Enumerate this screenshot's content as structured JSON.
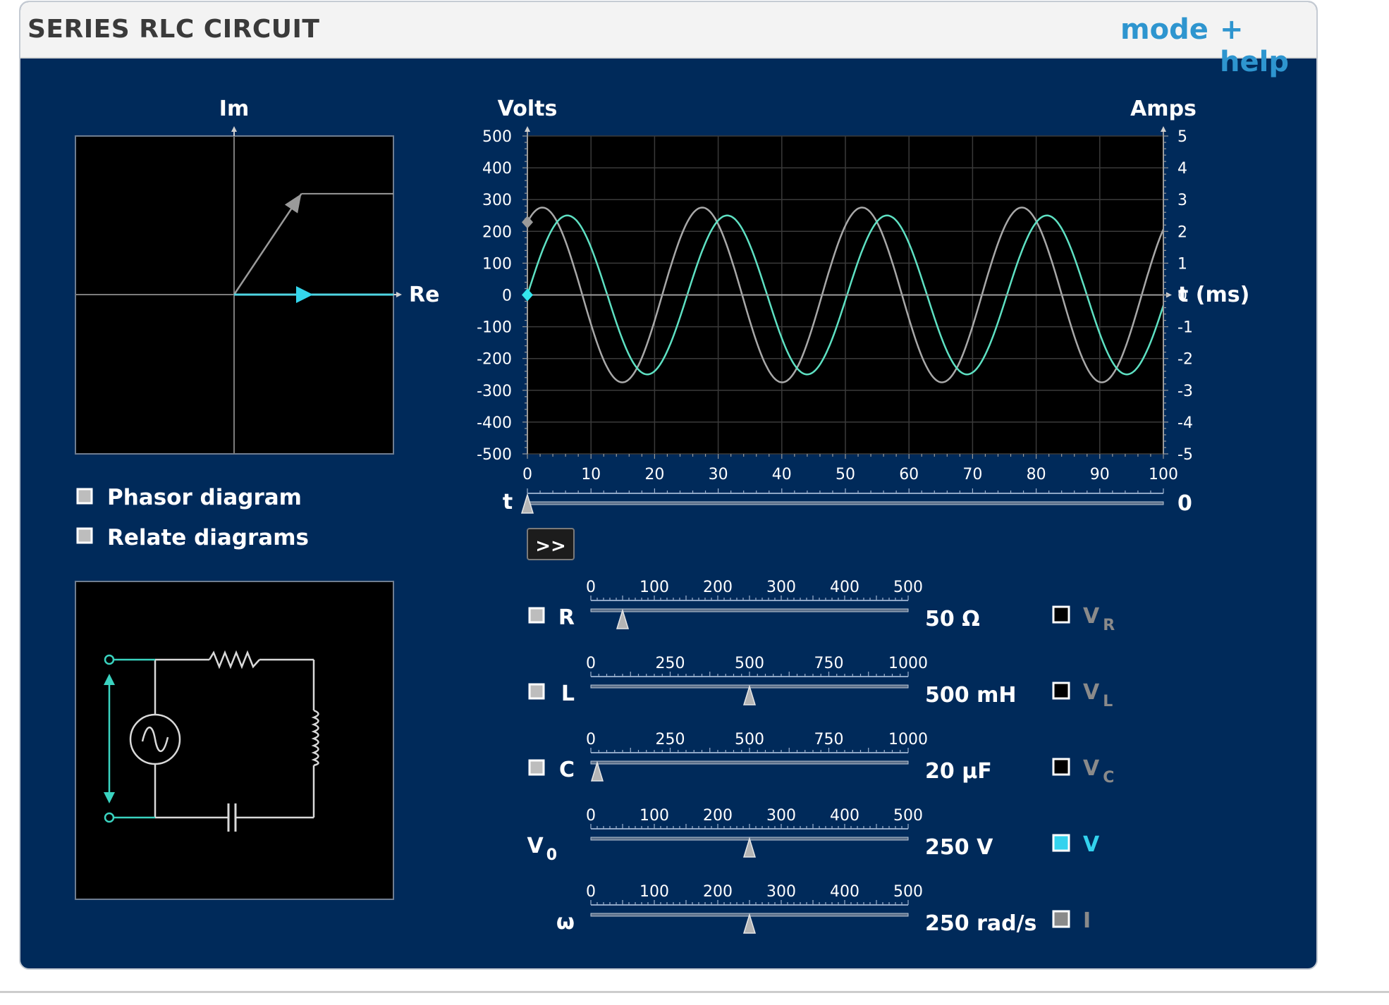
{
  "header": {
    "title": "SERIES RLC CIRCUIT",
    "mode_link": "mode",
    "help_link": "+ help"
  },
  "phasor": {
    "im_label": "Im",
    "re_label": "Re",
    "voltage_phase_deg": 56.3,
    "current_phase_deg": 0
  },
  "options": {
    "phasor_diagram": "Phasor diagram",
    "relate_diagrams": "Relate diagrams"
  },
  "chart_data": {
    "type": "line",
    "title": "",
    "xlabel": "t (ms)",
    "ylabel": "Volts",
    "y2label": "Amps",
    "xlim": [
      0,
      100
    ],
    "ylim": [
      -500,
      500
    ],
    "y2lim": [
      -5,
      5
    ],
    "x_ticks": [
      "0",
      "10",
      "20",
      "30",
      "40",
      "50",
      "60",
      "70",
      "80",
      "90",
      "100"
    ],
    "y_ticks": [
      "500",
      "400",
      "300",
      "200",
      "100",
      "0",
      "-100",
      "-200",
      "-300",
      "-400",
      "-500"
    ],
    "y2_ticks": [
      "5",
      "4",
      "3",
      "2",
      "1",
      "0",
      "-1",
      "-2",
      "-3",
      "-4",
      "-5"
    ],
    "grid": true,
    "series": [
      {
        "color": "#a8a8a8",
        "amplitude": 275,
        "omega_rad_per_s": 250,
        "phase_rad": 0.983,
        "axis": "left"
      },
      {
        "color": "#5ee1c3",
        "amplitude": 2.5,
        "omega_rad_per_s": 250,
        "phase_rad": 0,
        "axis": "right"
      }
    ]
  },
  "time_slider": {
    "label": "t",
    "value": 0,
    "value_text": "0",
    "max": 100
  },
  "play_button": ">>",
  "sliders": [
    {
      "key": "R",
      "label": "R",
      "has_checkbox": true,
      "ticks": [
        "0",
        "100",
        "200",
        "300",
        "400",
        "500"
      ],
      "max": 500,
      "value": 50,
      "value_text": "50 Ω"
    },
    {
      "key": "L",
      "label": "L",
      "has_checkbox": true,
      "ticks": [
        "0",
        "250",
        "500",
        "750",
        "1000"
      ],
      "max": 1000,
      "value": 500,
      "value_text": "500 mH"
    },
    {
      "key": "C",
      "label": "C",
      "has_checkbox": true,
      "ticks": [
        "0",
        "250",
        "500",
        "750",
        "1000"
      ],
      "max": 1000,
      "value": 20,
      "value_text": "20 µF"
    },
    {
      "key": "V0",
      "label": "V",
      "sub": "0",
      "has_checkbox": false,
      "ticks": [
        "0",
        "100",
        "200",
        "300",
        "400",
        "500"
      ],
      "max": 500,
      "value": 250,
      "value_text": "250 V"
    },
    {
      "key": "w",
      "label": "ω",
      "has_checkbox": false,
      "ticks": [
        "0",
        "100",
        "200",
        "300",
        "400",
        "500"
      ],
      "max": 500,
      "value": 250,
      "value_text": "250 rad/s"
    }
  ],
  "traces": [
    {
      "label": "V",
      "sub": "R",
      "checked": false,
      "color": "#8a8a8a"
    },
    {
      "label": "V",
      "sub": "L",
      "checked": false,
      "color": "#8a8a8a"
    },
    {
      "label": "V",
      "sub": "C",
      "checked": false,
      "color": "#8a8a8a"
    },
    {
      "label": "V",
      "sub": "",
      "checked": true,
      "color": "#33d2ee"
    },
    {
      "label": "I",
      "sub": "",
      "checked": true,
      "color": "#8a8a8a"
    }
  ],
  "colors": {
    "panel_bg": "#002a5a",
    "current_trace": "#5ee1c3",
    "voltage_trace": "#a8a8a8",
    "accent": "#33d2ee",
    "link": "#2e95cf"
  }
}
